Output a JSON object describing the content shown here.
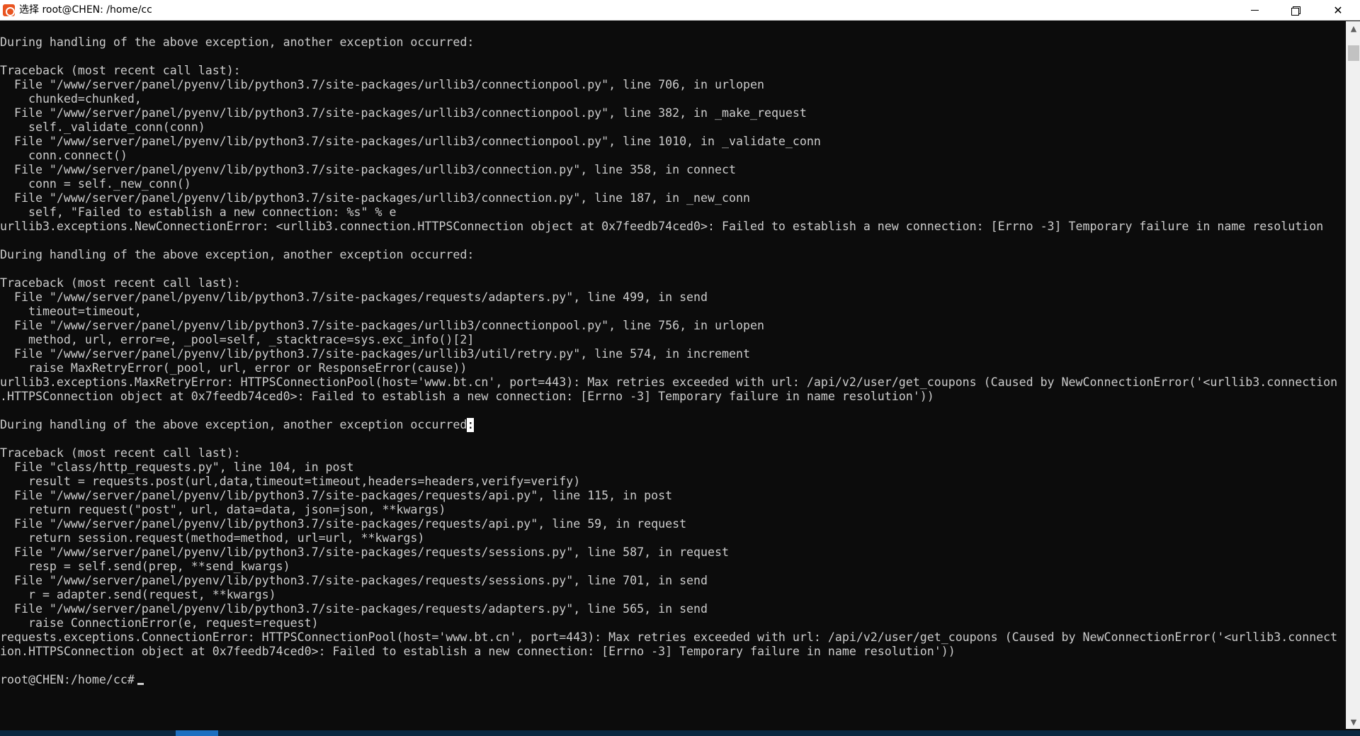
{
  "window": {
    "title": "选择 root@CHEN: /home/cc",
    "icon": "ubuntu-terminal-icon",
    "controls": {
      "minimize": "minimize-icon",
      "maximize": "restore-icon",
      "close": "✕"
    }
  },
  "terminal": {
    "lines": [
      "During handling of the above exception, another exception occurred:",
      "",
      "Traceback (most recent call last):",
      "  File \"/www/server/panel/pyenv/lib/python3.7/site-packages/urllib3/connectionpool.py\", line 706, in urlopen",
      "    chunked=chunked,",
      "  File \"/www/server/panel/pyenv/lib/python3.7/site-packages/urllib3/connectionpool.py\", line 382, in _make_request",
      "    self._validate_conn(conn)",
      "  File \"/www/server/panel/pyenv/lib/python3.7/site-packages/urllib3/connectionpool.py\", line 1010, in _validate_conn",
      "    conn.connect()",
      "  File \"/www/server/panel/pyenv/lib/python3.7/site-packages/urllib3/connection.py\", line 358, in connect",
      "    conn = self._new_conn()",
      "  File \"/www/server/panel/pyenv/lib/python3.7/site-packages/urllib3/connection.py\", line 187, in _new_conn",
      "    self, \"Failed to establish a new connection: %s\" % e",
      "urllib3.exceptions.NewConnectionError: <urllib3.connection.HTTPSConnection object at 0x7feedb74ced0>: Failed to establish a new connection: [Errno -3] Temporary failure in name resolution",
      "",
      "During handling of the above exception, another exception occurred:",
      "",
      "Traceback (most recent call last):",
      "  File \"/www/server/panel/pyenv/lib/python3.7/site-packages/requests/adapters.py\", line 499, in send",
      "    timeout=timeout,",
      "  File \"/www/server/panel/pyenv/lib/python3.7/site-packages/urllib3/connectionpool.py\", line 756, in urlopen",
      "    method, url, error=e, _pool=self, _stacktrace=sys.exc_info()[2]",
      "  File \"/www/server/panel/pyenv/lib/python3.7/site-packages/urllib3/util/retry.py\", line 574, in increment",
      "    raise MaxRetryError(_pool, url, error or ResponseError(cause))",
      "urllib3.exceptions.MaxRetryError: HTTPSConnectionPool(host='www.bt.cn', port=443): Max retries exceeded with url: /api/v2/user/get_coupons (Caused by NewConnectionError('<urllib3.connection",
      ".HTTPSConnection object at 0x7feedb74ced0>: Failed to establish a new connection: [Errno -3] Temporary failure in name resolution'))",
      "",
      "During handling of the above exception, another exception occurred",
      "",
      "Traceback (most recent call last):",
      "  File \"class/http_requests.py\", line 104, in post",
      "    result = requests.post(url,data,timeout=timeout,headers=headers,verify=verify)",
      "  File \"/www/server/panel/pyenv/lib/python3.7/site-packages/requests/api.py\", line 115, in post",
      "    return request(\"post\", url, data=data, json=json, **kwargs)",
      "  File \"/www/server/panel/pyenv/lib/python3.7/site-packages/requests/api.py\", line 59, in request",
      "    return session.request(method=method, url=url, **kwargs)",
      "  File \"/www/server/panel/pyenv/lib/python3.7/site-packages/requests/sessions.py\", line 587, in request",
      "    resp = self.send(prep, **send_kwargs)",
      "  File \"/www/server/panel/pyenv/lib/python3.7/site-packages/requests/sessions.py\", line 701, in send",
      "    r = adapter.send(request, **kwargs)",
      "  File \"/www/server/panel/pyenv/lib/python3.7/site-packages/requests/adapters.py\", line 565, in send",
      "    raise ConnectionError(e, request=request)",
      "requests.exceptions.ConnectionError: HTTPSConnectionPool(host='www.bt.cn', port=443): Max retries exceeded with url: /api/v2/user/get_coupons (Caused by NewConnectionError('<urllib3.connect",
      "ion.HTTPSConnection object at 0x7feedb74ced0>: Failed to establish a new connection: [Errno -3] Temporary failure in name resolution'))",
      ""
    ],
    "selected_char": ":",
    "selected_line_index": 27,
    "prompt": "root@CHEN:/home/cc# "
  },
  "colors": {
    "background": "#0c0c0c",
    "foreground": "#cccccc",
    "titlebar": "#ffffff",
    "taskbar": "#0a2740",
    "taskbar_active": "#1d6fc0"
  },
  "scrollbar": {
    "up_icon": "▲",
    "down_icon": "▼"
  }
}
